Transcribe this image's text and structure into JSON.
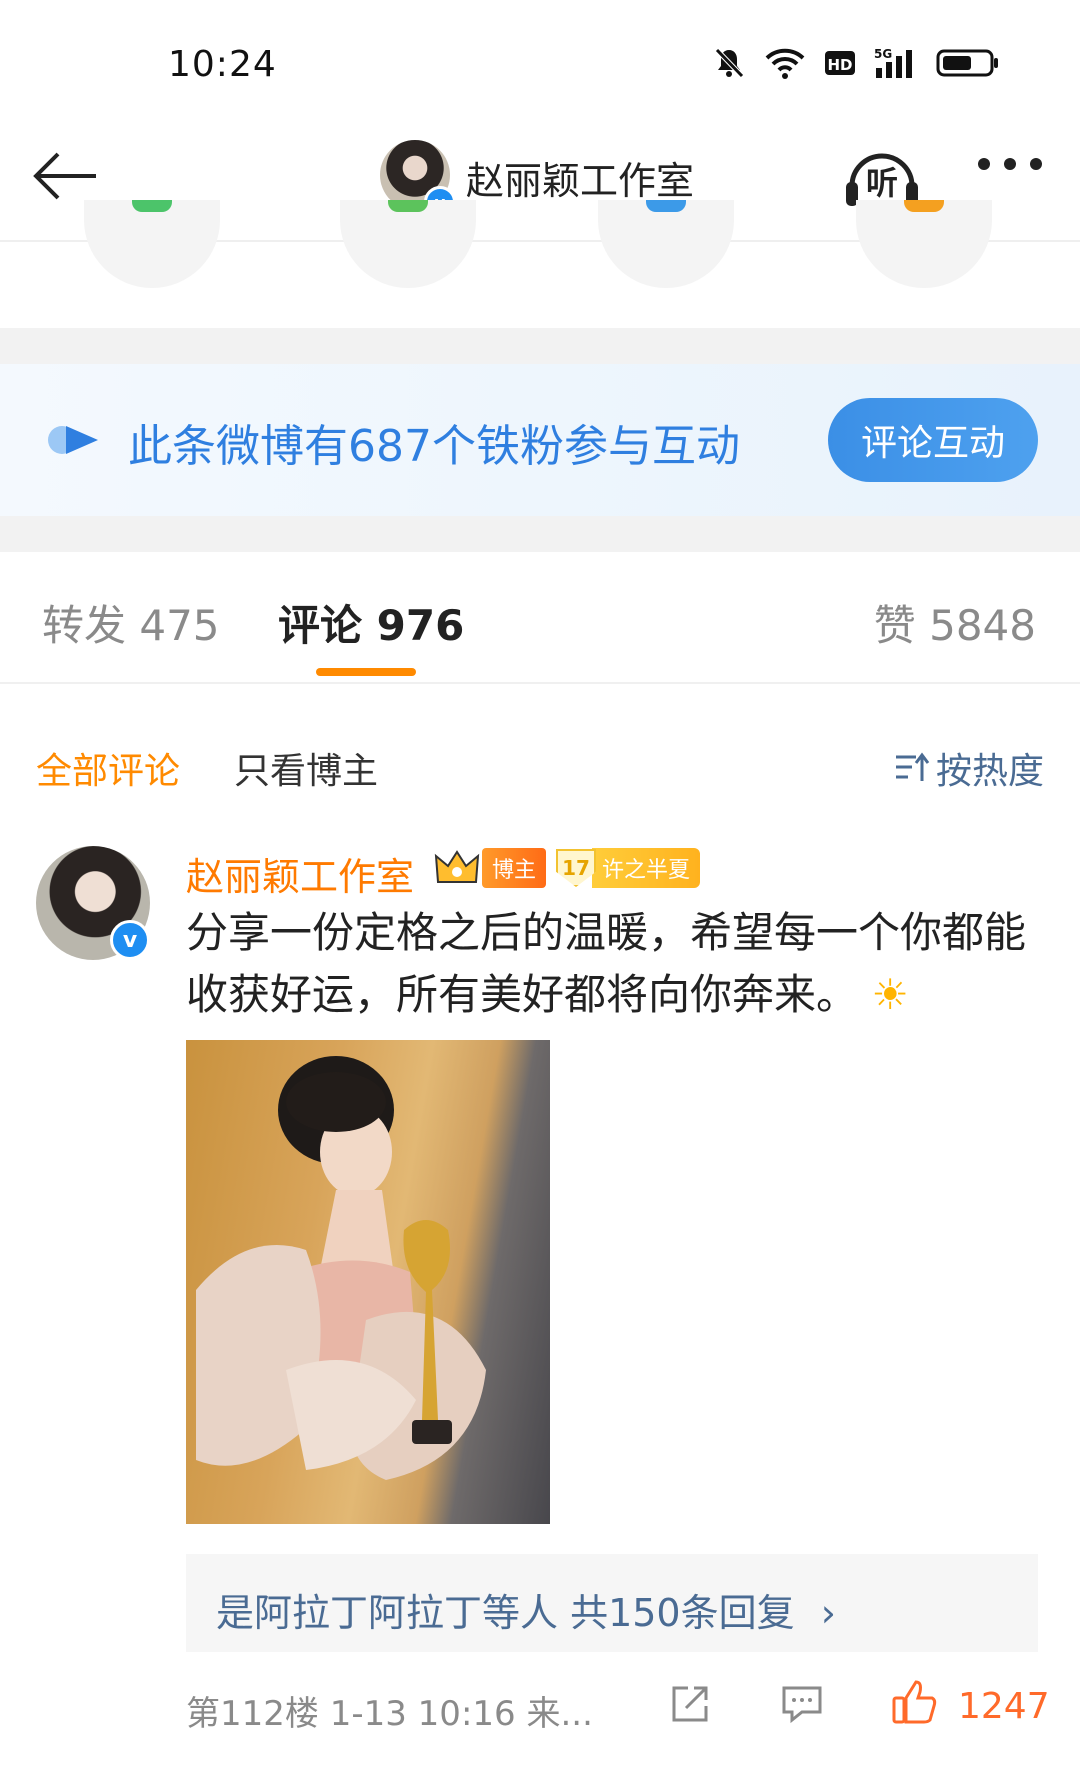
{
  "status_bar": {
    "time": "10:24",
    "network": "5G"
  },
  "header": {
    "title": "赵丽颖工作室",
    "listen_label": "听"
  },
  "fan_banner": {
    "text": "此条微博有687个铁粉参与互动",
    "button_label": "评论互动"
  },
  "tabs": [
    {
      "label": "转发 475",
      "active": false
    },
    {
      "label": "评论 976",
      "active": true
    },
    {
      "label": "赞 5848",
      "active": false
    }
  ],
  "filter": {
    "all": "全部评论",
    "author_only": "只看博主",
    "sort": "按热度"
  },
  "comment": {
    "author": "赵丽颖工作室",
    "owner_badge": "博主",
    "fan_level": "17",
    "fan_name": "许之半夏",
    "text": "分享一份定格之后的温暖，希望每一个你都能收获好运，所有美好都将向你奔来。",
    "emoji": "☀",
    "replies_text": "是阿拉丁阿拉丁等人  共150条回复",
    "replies_chevron": "›",
    "meta": "第112楼 1-13 10:16 来...",
    "like_count": "1247"
  },
  "colors": {
    "accent_orange": "#ff8a00",
    "link_blue": "#4a6b93",
    "banner_blue": "#2f7fe0"
  }
}
